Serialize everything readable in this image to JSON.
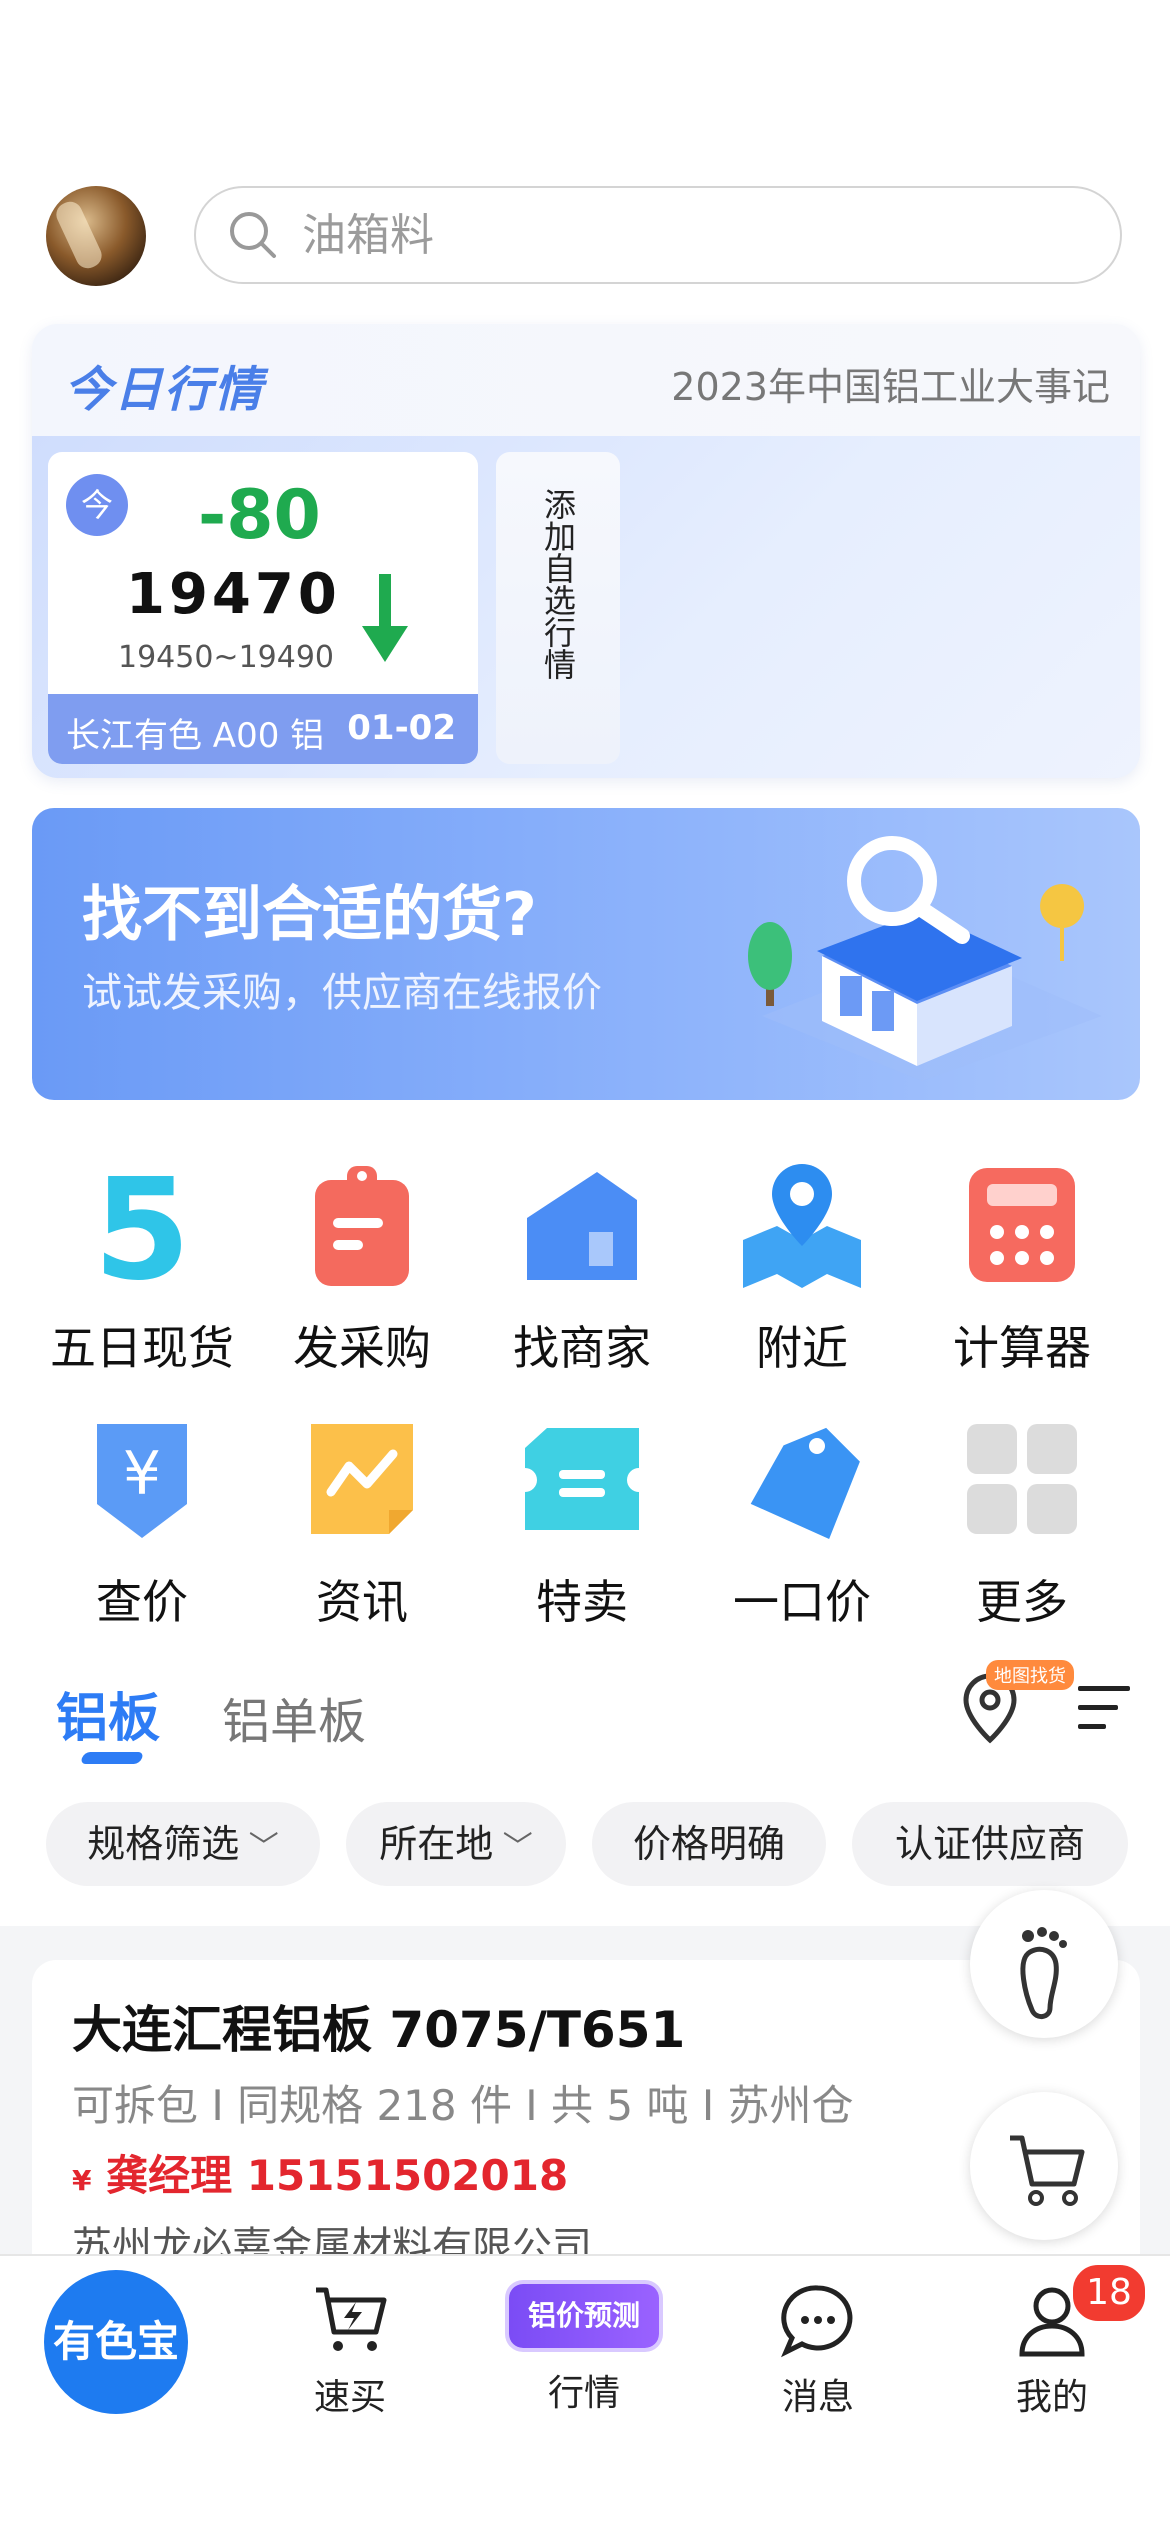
{
  "search": {
    "placeholder": "油箱料"
  },
  "market": {
    "title": "今日行情",
    "event_link": "2023年中国铝工业大事记",
    "quote": {
      "today_label": "今",
      "change": "-80",
      "price": "19470",
      "range": "19450~19490",
      "name": "长江有色 A00 铝",
      "date": "01-02"
    },
    "add_watch": "添加自选行情"
  },
  "banner": {
    "title": "找不到合适的货?",
    "subtitle": "试试发采购，供应商在线报价"
  },
  "grid": [
    {
      "label": "五日现货",
      "icon": "five-day-icon"
    },
    {
      "label": "发采购",
      "icon": "purchase-clipboard-icon"
    },
    {
      "label": "找商家",
      "icon": "store-house-icon"
    },
    {
      "label": "附近",
      "icon": "map-pin-icon"
    },
    {
      "label": "计算器",
      "icon": "calculator-icon"
    },
    {
      "label": "查价",
      "icon": "yen-shield-icon"
    },
    {
      "label": "资讯",
      "icon": "news-trend-icon"
    },
    {
      "label": "特卖",
      "icon": "ticket-icon"
    },
    {
      "label": "一口价",
      "icon": "price-tag-icon"
    },
    {
      "label": "更多",
      "icon": "more-grid-icon"
    }
  ],
  "tabs": {
    "active": "铝板",
    "second": "铝单板",
    "map_badge": "地图找货"
  },
  "chips": [
    "规格筛选",
    "所在地",
    "价格明确",
    "认证供应商"
  ],
  "product": {
    "title": "大连汇程铝板 7075/T651",
    "meta": "可拆包 I 同规格 218 件 I 共 5 吨 I 苏州仓",
    "currency": "¥",
    "contact": "龚经理 15151502018",
    "company": "苏州龙必嘉金属材料有限公司"
  },
  "tabbar": {
    "logo": "有色宝",
    "items": [
      "速买",
      "行情",
      "消息",
      "我的"
    ],
    "predict": "铝价预测",
    "badge": "18"
  },
  "colors": {
    "accent": "#2d7cf5",
    "down": "#1faa4f",
    "price_red": "#e3262e"
  }
}
